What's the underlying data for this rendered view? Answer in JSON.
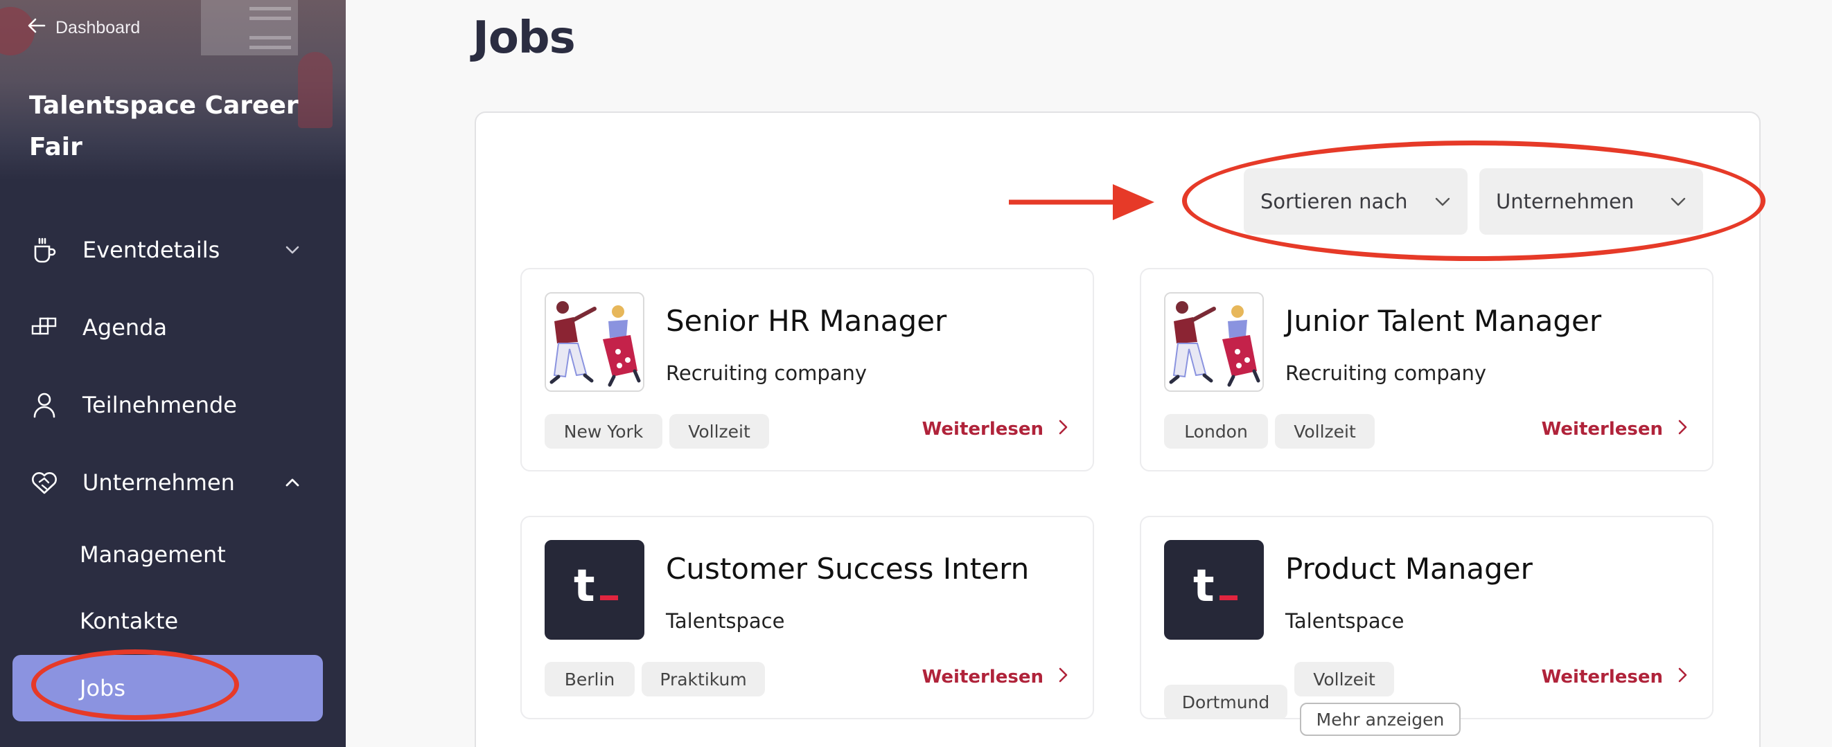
{
  "sidebar": {
    "back_label": "Dashboard",
    "event_title": "Talentspace Career Fair",
    "items": [
      {
        "label": "Eventdetails",
        "icon": "coffee-cup-icon",
        "expanded": false
      },
      {
        "label": "Agenda",
        "icon": "agenda-blocks-icon"
      },
      {
        "label": "Teilnehmende",
        "icon": "person-icon"
      },
      {
        "label": "Unternehmen",
        "icon": "handshake-icon",
        "expanded": true
      }
    ],
    "subitems": [
      {
        "label": "Management"
      },
      {
        "label": "Kontakte"
      },
      {
        "label": "Jobs",
        "active": true
      }
    ]
  },
  "main": {
    "title": "Jobs",
    "sort_label": "Sortieren nach",
    "company_filter_label": "Unternehmen"
  },
  "jobs": [
    {
      "title": "Senior HR Manager",
      "company": "Recruiting company",
      "tags": [
        "New York",
        "Vollzeit"
      ],
      "read_more": "Weiterlesen",
      "logo": "illustration-people-icon"
    },
    {
      "title": "Junior Talent Manager",
      "company": "Recruiting company",
      "tags": [
        "London",
        "Vollzeit"
      ],
      "read_more": "Weiterlesen",
      "logo": "illustration-people-icon"
    },
    {
      "title": "Customer Success Intern",
      "company": "Talentspace",
      "tags": [
        "Berlin",
        "Praktikum"
      ],
      "read_more": "Weiterlesen",
      "logo": "talentspace-logo"
    },
    {
      "title": "Product Manager",
      "company": "Talentspace",
      "tags": [
        "Dortmund",
        "Vollzeit"
      ],
      "more_label": "Mehr anzeigen",
      "read_more": "Weiterlesen",
      "logo": "talentspace-logo"
    }
  ],
  "colors": {
    "sidebar_bg": "#2b2d41",
    "active_item_bg": "#8b93e0",
    "accent_red": "#b0233a",
    "annotation_red": "#e63a28"
  }
}
